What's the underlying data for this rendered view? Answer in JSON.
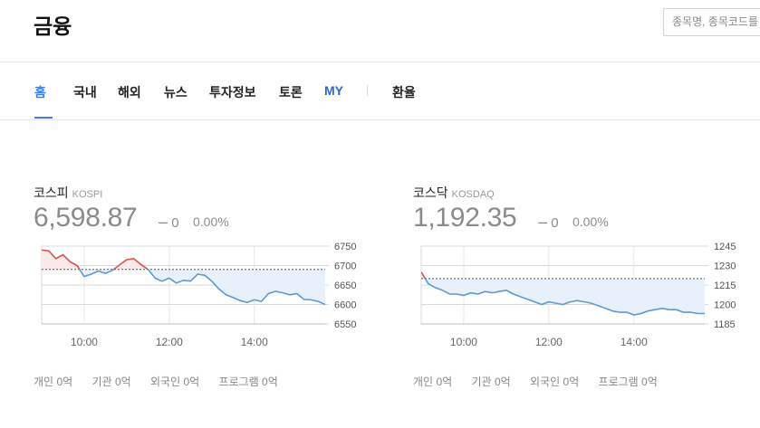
{
  "header": {
    "title": "금융",
    "search_placeholder": "종목명, 종목코드를"
  },
  "tabs": [
    {
      "label": "홈",
      "active": true
    },
    {
      "label": "국내"
    },
    {
      "label": "해외"
    },
    {
      "label": "뉴스"
    },
    {
      "label": "투자정보"
    },
    {
      "label": "토론"
    },
    {
      "label": "MY"
    },
    {
      "label": "환율"
    }
  ],
  "colors": {
    "accent": "#3c7ef0",
    "up": "#d9534f",
    "down": "#5b9bd5",
    "fill": "#e8f1fb"
  },
  "indices": [
    {
      "name": "코스피",
      "code": "KOSPI",
      "value": "6,598.87",
      "change": "0",
      "change_pct": "0.00%",
      "flows": [
        {
          "label": "개인",
          "value": "0억"
        },
        {
          "label": "기관",
          "value": "0억"
        },
        {
          "label": "외국인",
          "value": "0억"
        },
        {
          "label": "프로그램",
          "value": "0억"
        }
      ],
      "x_ticks": [
        "10:00",
        "12:00",
        "14:00"
      ],
      "y_ticks": [
        "6750",
        "6700",
        "6650",
        "6600",
        "6550"
      ]
    },
    {
      "name": "코스닥",
      "code": "KOSDAQ",
      "value": "1,192.35",
      "change": "0",
      "change_pct": "0.00%",
      "flows": [
        {
          "label": "개인",
          "value": "0억"
        },
        {
          "label": "기관",
          "value": "0억"
        },
        {
          "label": "외국인",
          "value": "0억"
        },
        {
          "label": "프로그램",
          "value": "0억"
        }
      ],
      "x_ticks": [
        "10:00",
        "12:00",
        "14:00"
      ],
      "y_ticks": [
        "1245",
        "1230",
        "1215",
        "1200",
        "1185"
      ]
    }
  ],
  "chart_data": [
    {
      "type": "line",
      "title": "KOSPI",
      "ylim": [
        6550,
        6750
      ],
      "x_range": [
        "09:00",
        "15:40"
      ],
      "reference": 6690,
      "grid": true,
      "x": [
        "09:00",
        "09:10",
        "09:20",
        "09:30",
        "09:40",
        "09:50",
        "10:00",
        "10:10",
        "10:20",
        "10:30",
        "10:40",
        "10:50",
        "11:00",
        "11:10",
        "11:20",
        "11:30",
        "11:40",
        "11:50",
        "12:00",
        "12:10",
        "12:20",
        "12:30",
        "12:40",
        "12:50",
        "13:00",
        "13:10",
        "13:20",
        "13:30",
        "13:40",
        "13:50",
        "14:00",
        "14:10",
        "14:20",
        "14:30",
        "14:40",
        "14:50",
        "15:00",
        "15:10",
        "15:20",
        "15:30",
        "15:40"
      ],
      "values": [
        6740,
        6738,
        6718,
        6728,
        6710,
        6700,
        6672,
        6678,
        6686,
        6680,
        6688,
        6702,
        6715,
        6718,
        6703,
        6690,
        6668,
        6660,
        6668,
        6655,
        6662,
        6660,
        6678,
        6675,
        6660,
        6640,
        6625,
        6618,
        6610,
        6605,
        6612,
        6608,
        6628,
        6634,
        6630,
        6625,
        6628,
        6613,
        6612,
        6608,
        6600
      ]
    },
    {
      "type": "line",
      "title": "KOSDAQ",
      "ylim": [
        1185,
        1245
      ],
      "x_range": [
        "09:00",
        "15:40"
      ],
      "reference": 1220,
      "grid": true,
      "x": [
        "09:00",
        "09:10",
        "09:20",
        "09:30",
        "09:40",
        "09:50",
        "10:00",
        "10:10",
        "10:20",
        "10:30",
        "10:40",
        "10:50",
        "11:00",
        "11:10",
        "11:20",
        "11:30",
        "11:40",
        "11:50",
        "12:00",
        "12:10",
        "12:20",
        "12:30",
        "12:40",
        "12:50",
        "13:00",
        "13:10",
        "13:20",
        "13:30",
        "13:40",
        "13:50",
        "14:00",
        "14:10",
        "14:20",
        "14:30",
        "14:40",
        "14:50",
        "15:00",
        "15:10",
        "15:20",
        "15:30",
        "15:40"
      ],
      "values": [
        1225,
        1216,
        1213,
        1211,
        1208,
        1208,
        1207,
        1209,
        1208,
        1210,
        1209,
        1210,
        1211,
        1208,
        1206,
        1204,
        1202,
        1200,
        1202,
        1201,
        1200,
        1202,
        1203,
        1202,
        1201,
        1199,
        1197,
        1195,
        1194,
        1194,
        1192,
        1193,
        1195,
        1196,
        1197,
        1196,
        1196,
        1194,
        1194,
        1193,
        1193
      ]
    }
  ]
}
